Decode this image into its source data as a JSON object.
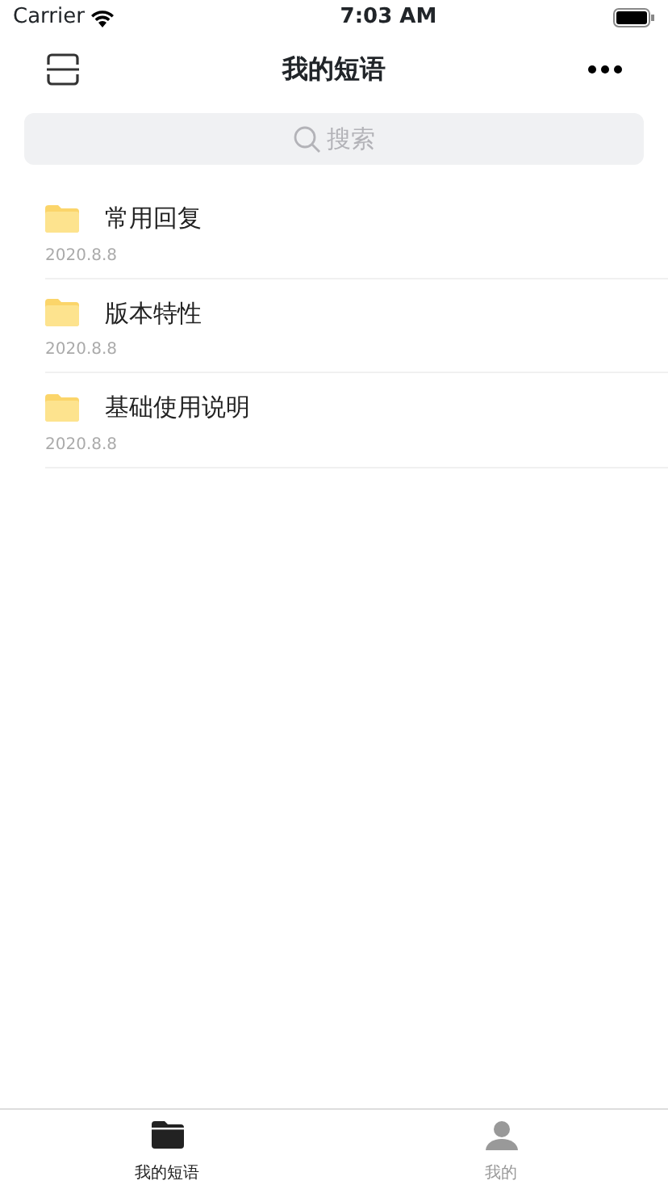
{
  "status_bar": {
    "carrier": "Carrier",
    "time": "7:03 AM"
  },
  "nav": {
    "title": "我的短语"
  },
  "search": {
    "placeholder": "搜索"
  },
  "folders": [
    {
      "name": "常用回复",
      "date": "2020.8.8"
    },
    {
      "name": "版本特性",
      "date": "2020.8.8"
    },
    {
      "name": "基础使用说明",
      "date": "2020.8.8"
    }
  ],
  "tabs": [
    {
      "label": "我的短语",
      "kind": "folder",
      "selected": true
    },
    {
      "label": "我的",
      "kind": "person",
      "selected": false
    }
  ]
}
